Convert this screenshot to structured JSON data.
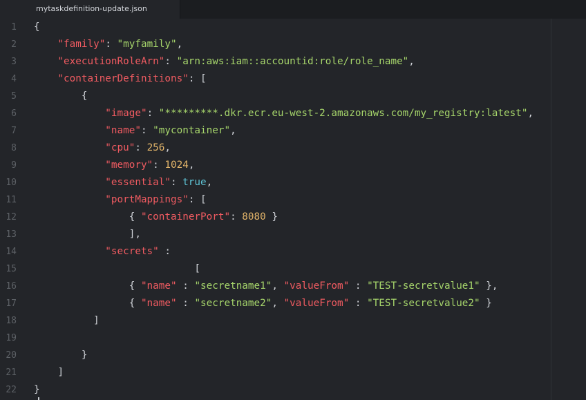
{
  "tab": {
    "label": "mytaskdefinition-update.json"
  },
  "line_numbers": [
    "1",
    "2",
    "3",
    "4",
    "5",
    "6",
    "7",
    "8",
    "9",
    "10",
    "11",
    "12",
    "13",
    "14",
    "15",
    "16",
    "17",
    "18",
    "19",
    "20",
    "21",
    "22"
  ],
  "code": {
    "l1": {
      "p1": "{"
    },
    "l2": {
      "k1": "\"family\"",
      "p1": ": ",
      "s1": "\"myfamily\"",
      "p2": ","
    },
    "l3": {
      "k1": "\"executionRoleArn\"",
      "p1": ": ",
      "s1": "\"arn:aws:iam::accountid:role/role_name\"",
      "p2": ","
    },
    "l4": {
      "k1": "\"containerDefinitions\"",
      "p1": ": ["
    },
    "l5": {
      "p1": "{"
    },
    "l6": {
      "k1": "\"image\"",
      "p1": ": ",
      "s1": "\"*********.dkr.ecr.eu-west-2.amazonaws.com/my_registry:latest\"",
      "p2": ","
    },
    "l7": {
      "k1": "\"name\"",
      "p1": ": ",
      "s1": "\"mycontainer\"",
      "p2": ","
    },
    "l8": {
      "k1": "\"cpu\"",
      "p1": ": ",
      "n1": "256",
      "p2": ","
    },
    "l9": {
      "k1": "\"memory\"",
      "p1": ": ",
      "n1": "1024",
      "p2": ","
    },
    "l10": {
      "k1": "\"essential\"",
      "p1": ": ",
      "b1": "true",
      "p2": ","
    },
    "l11": {
      "k1": "\"portMappings\"",
      "p1": ": ["
    },
    "l12": {
      "p1": "{ ",
      "k1": "\"containerPort\"",
      "p2": ": ",
      "n1": "8080",
      "p3": " }"
    },
    "l13": {
      "p1": "],"
    },
    "l14": {
      "k1": "\"secrets\"",
      "p1": " :"
    },
    "l15": {
      "p1": "["
    },
    "l16": {
      "p1": "{ ",
      "k1": "\"name\"",
      "p2": " : ",
      "s1": "\"secretname1\"",
      "p3": ", ",
      "k2": "\"valueFrom\"",
      "p4": " : ",
      "s2": "\"TEST-secretvalue1\"",
      "p5": " },"
    },
    "l17": {
      "p1": "{ ",
      "k1": "\"name\"",
      "p2": " : ",
      "s1": "\"secretname2\"",
      "p3": ", ",
      "k2": "\"valueFrom\"",
      "p4": " : ",
      "s2": "\"TEST-secretvalue2\"",
      "p5": " }"
    },
    "l18": {
      "p1": "]"
    },
    "l20": {
      "p1": "}"
    },
    "l21": {
      "p1": "]"
    },
    "l22": {
      "p1": "}"
    }
  },
  "colors": {
    "background": "#232529",
    "key": "#f05b61",
    "string": "#a6d56b",
    "number": "#e3b56a",
    "boolean": "#5fc6d8"
  }
}
